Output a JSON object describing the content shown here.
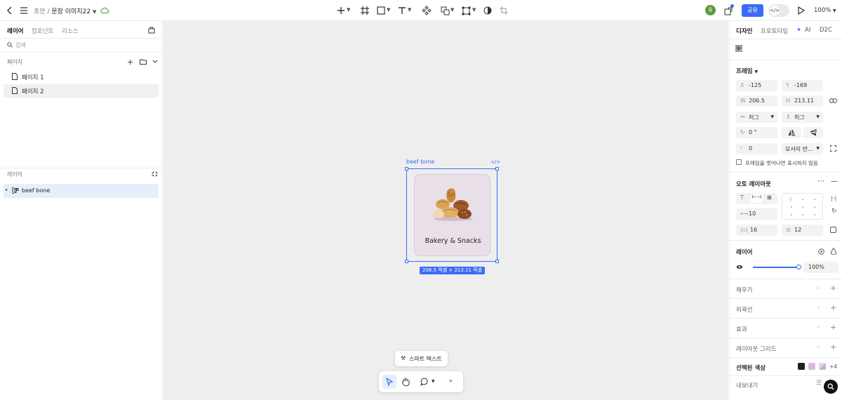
{
  "topbar": {
    "breadcrumb_parent": "초안",
    "breadcrumb_sep": "/",
    "file_name": "문장 이미지22",
    "avatar_letter": "유",
    "share_label": "공유",
    "zoom": "100%"
  },
  "left": {
    "tabs": [
      "레이어",
      "컴포넌트",
      "리소스"
    ],
    "search_placeholder": "검색",
    "pages_header": "페이지",
    "pages": [
      "페이지 1",
      "페이지 2"
    ],
    "layers_header": "레이어",
    "layer_item": "beef bone"
  },
  "canvas": {
    "frame_label": "beef bone",
    "card_text": "Bakery & Snacks",
    "dimension_label": "206.5 픽셀 × 213.11 픽셀",
    "smart_text_label": "스마트 텍스트"
  },
  "right": {
    "tabs": [
      "디자인",
      "프로토타입",
      "AI",
      "D2C"
    ],
    "frame_title": "프레임",
    "x_label": "X",
    "x": "-125",
    "y_label": "Y",
    "y": "-169",
    "w_label": "W",
    "w": "206.5",
    "h_label": "H",
    "h": "213.11",
    "hug_w": "허그",
    "hug_h": "허그",
    "rotation": "0 °",
    "radius": "0",
    "corner_mode": "모서리 반...",
    "clip_label": "프레임을 벗어나면 표시하지 않음",
    "autolayout_title": "오토 레이아웃",
    "gap": "10",
    "pad_h": "16",
    "pad_v": "12",
    "layer_title": "레이어",
    "opacity": "100%",
    "fill_title": "채우기",
    "stroke_title": "외곽선",
    "effect_title": "효과",
    "layout_grid_title": "레이아웃 그리드",
    "selected_colors_title": "선택된 색상",
    "selected_colors_extra": "+4",
    "export_title": "내보내기",
    "colors": {
      "swatch1": "#1f1f1f",
      "swatch2": "#d8b9e0",
      "swatch3": "#e6d4ea"
    }
  },
  "colors": {
    "accent": "#3b6cf6",
    "card_bg": "#e9dfe9",
    "avatar_bg": "#5b9a3c",
    "notification": "#3b6cf6"
  }
}
